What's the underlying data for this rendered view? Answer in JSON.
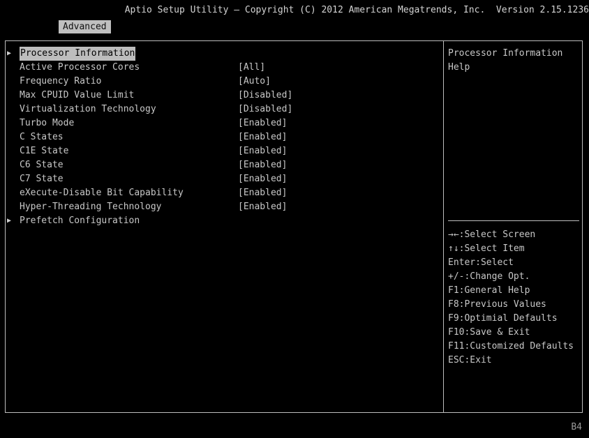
{
  "header": {
    "title": "Aptio Setup Utility – Copyright (C) 2012 American Megatrends, Inc.  Version 2.15.1236",
    "active_tab": "Advanced"
  },
  "settings": [
    {
      "label": "Processor Information",
      "value": "",
      "submenu": true,
      "selected": true
    },
    {
      "label": "Active Processor Cores",
      "value": "[All]"
    },
    {
      "label": "Frequency Ratio",
      "value": "[Auto]"
    },
    {
      "label": "Max CPUID Value Limit",
      "value": "[Disabled]"
    },
    {
      "label": "Virtualization Technology",
      "value": "[Disabled]"
    },
    {
      "label": "Turbo Mode",
      "value": "[Enabled]"
    },
    {
      "label": "C States",
      "value": "[Enabled]"
    },
    {
      "label": "C1E State",
      "value": "[Enabled]"
    },
    {
      "label": "C6 State",
      "value": "[Enabled]"
    },
    {
      "label": "C7 State",
      "value": "[Enabled]"
    },
    {
      "label": "eXecute-Disable Bit Capability",
      "value": "[Enabled]"
    },
    {
      "label": "Hyper-Threading Technology",
      "value": "[Enabled]"
    },
    {
      "label": "Prefetch Configuration",
      "value": "",
      "submenu": true
    }
  ],
  "help": {
    "text": "Processor Information Help"
  },
  "keys": [
    "→←:Select Screen",
    "↑↓:Select Item",
    "Enter:Select",
    "+/-:Change Opt.",
    "F1:General Help",
    "F8:Previous Values",
    "F9:Optimial Defaults",
    "F10:Save & Exit",
    "F11:Customized Defaults",
    "ESC:Exit"
  ],
  "footer": {
    "code": "B4"
  },
  "colors": {
    "background": "#000000",
    "text": "#c8c8c8",
    "highlight": "#bdbdbd"
  }
}
